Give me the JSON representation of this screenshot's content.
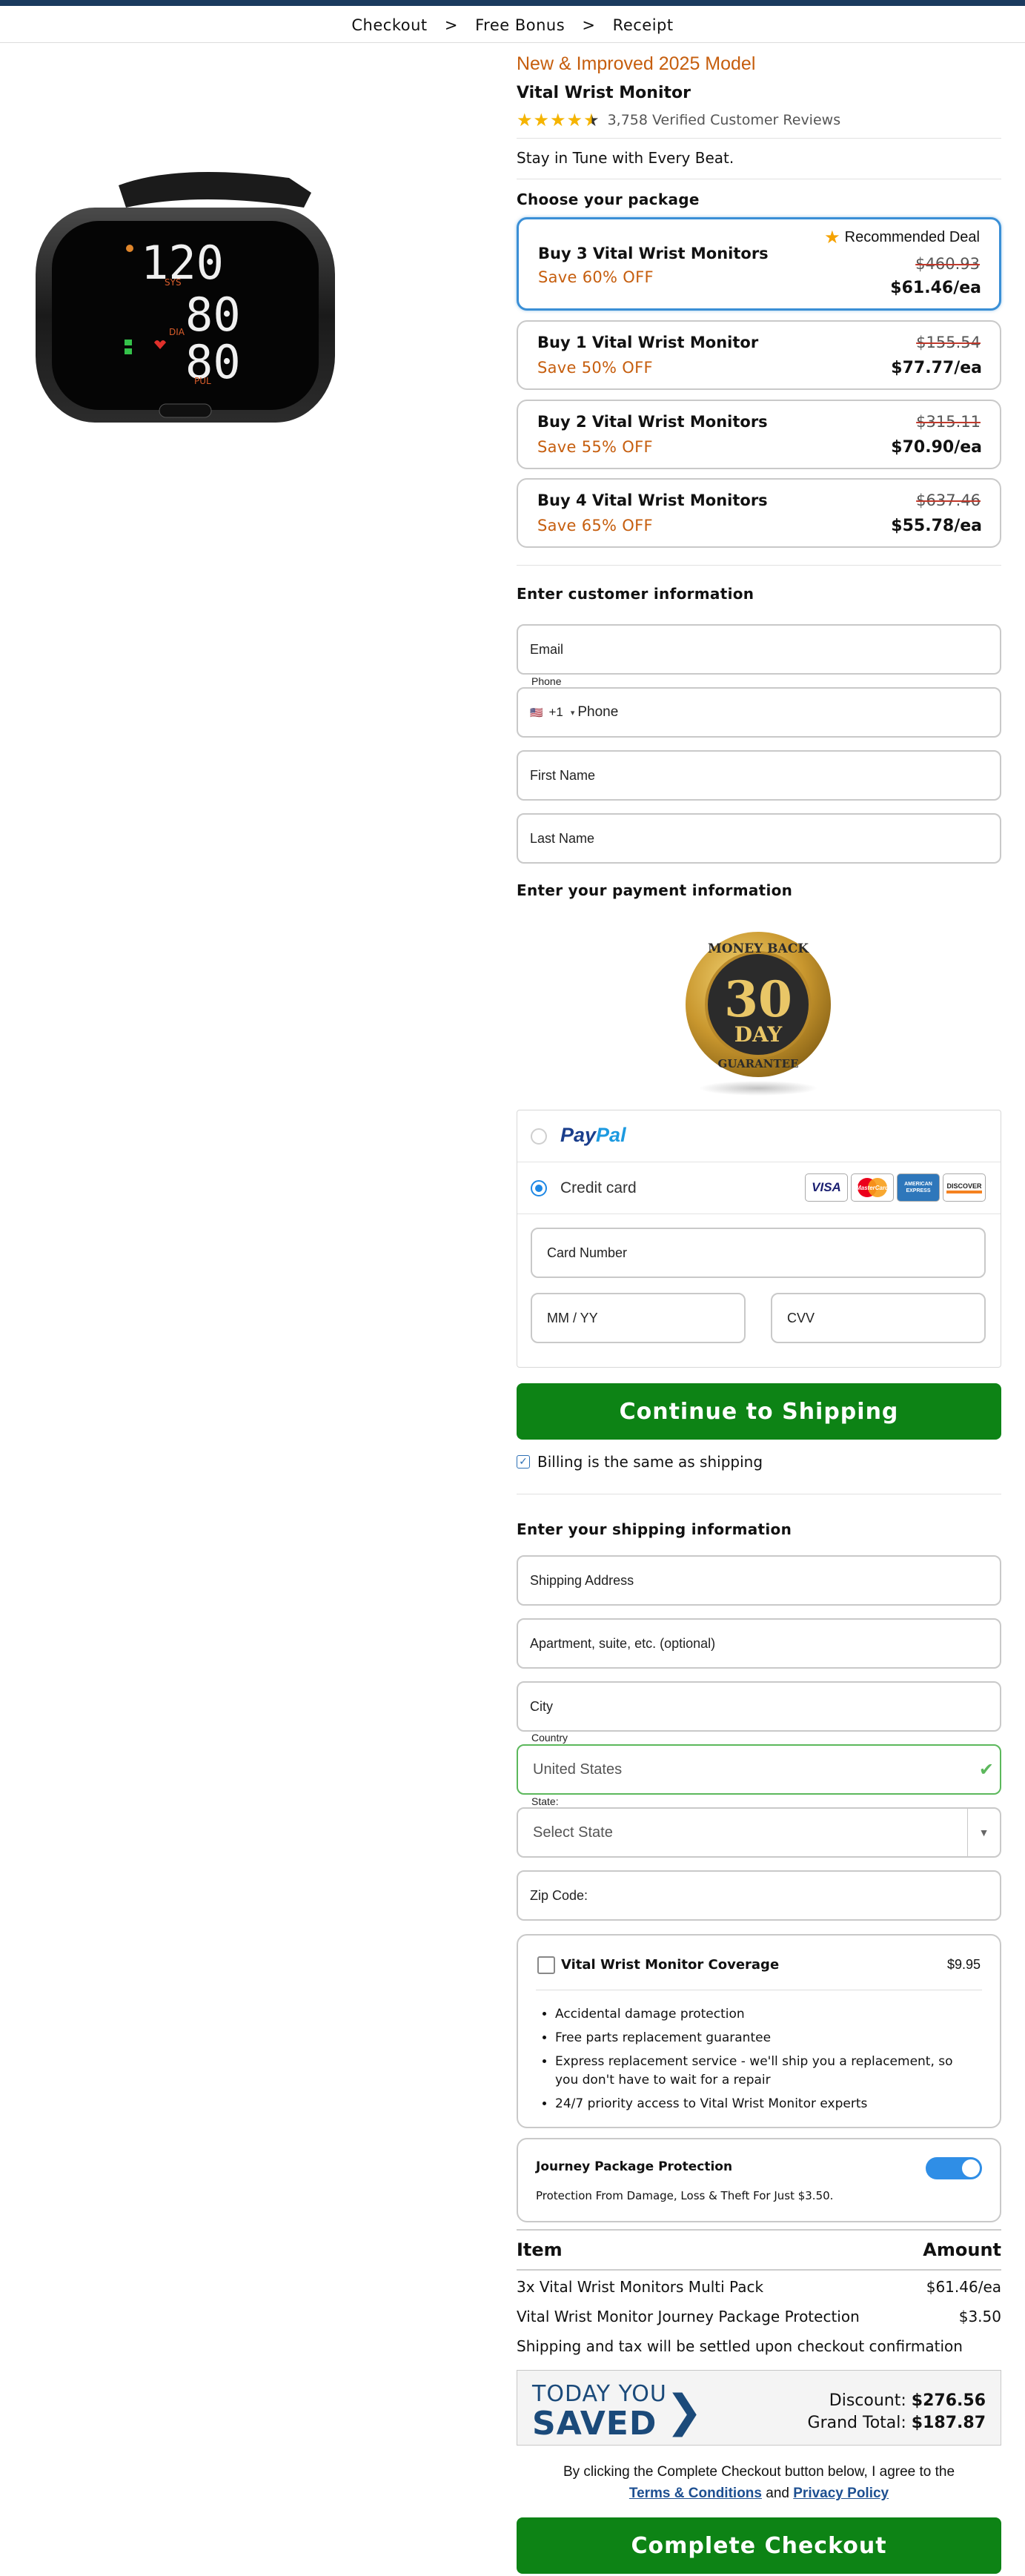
{
  "breadcrumb": [
    "Checkout",
    "Free Bonus",
    "Receipt"
  ],
  "breadcrumb_separator": ">",
  "product": {
    "subtitle": "New & Improved 2025 Model",
    "title": "Vital Wrist Monitor",
    "rating_stars": 4.5,
    "reviews": "3,758 Verified Customer Reviews",
    "tagline": "Stay in Tune with Every Beat.",
    "image_readings": [
      "120",
      "80",
      "80"
    ],
    "image_labels": [
      "SYS",
      "DIA",
      "PUL"
    ]
  },
  "packages_heading": "Choose your package",
  "packages": [
    {
      "name": "Buy 3 Vital Wrist Monitors",
      "save": "Save 60% OFF",
      "old": "$460.93",
      "price": "$61.46/ea",
      "badge": "Recommended Deal",
      "selected": true
    },
    {
      "name": "Buy 1 Vital Wrist Monitor",
      "save": "Save 50% OFF",
      "old": "$155.54",
      "price": "$77.77/ea"
    },
    {
      "name": "Buy 2 Vital Wrist Monitors",
      "save": "Save 55% OFF",
      "old": "$315.11",
      "price": "$70.90/ea"
    },
    {
      "name": "Buy 4 Vital Wrist Monitors",
      "save": "Save 65% OFF",
      "old": "$637.46",
      "price": "$55.78/ea"
    }
  ],
  "customer": {
    "heading": "Enter customer information",
    "email": "Email",
    "phone_label": "Phone",
    "phone_code": "+1",
    "phone_placeholder": "Phone",
    "first_name": "First Name",
    "last_name": "Last Name"
  },
  "payment": {
    "heading": "Enter your payment information",
    "guarantee": {
      "top": "MONEY BACK",
      "num": "30",
      "day": "DAY",
      "bottom": "GUARANTEE"
    },
    "paypal_1": "Pay",
    "paypal_2": "Pal",
    "credit_card": "Credit card",
    "cards": [
      "VISA",
      "MasterCard",
      "AMERICAN EXPRESS",
      "DISCOVER"
    ],
    "card_number": "Card Number",
    "expiry": "MM / YY",
    "cvv": "CVV"
  },
  "continue_button": "Continue to Shipping",
  "billing_same": "Billing is the same as shipping",
  "shipping": {
    "heading": "Enter your shipping information",
    "address": "Shipping Address",
    "apartment": "Apartment, suite, etc. (optional)",
    "city": "City",
    "country_label": "Country",
    "country_value": "United States",
    "state_label": "State:",
    "state_value": "Select State",
    "zip": "Zip Code:"
  },
  "coverage": {
    "title": "Vital Wrist Monitor Coverage",
    "price": "$9.95",
    "items": [
      "Accidental damage protection",
      "Free parts replacement guarantee",
      "Express replacement service - we'll ship you a replacement, so you don't have to wait for a repair",
      "24/7 priority access to Vital Wrist Monitor experts"
    ]
  },
  "journey": {
    "title": "Journey Package Protection",
    "desc": "Protection From Damage, Loss & Theft For Just $3.50.",
    "enabled": true
  },
  "summary": {
    "col_item": "Item",
    "col_amount": "Amount",
    "rows": [
      {
        "item": "3x Vital Wrist Monitors Multi Pack",
        "amount": "$61.46/ea"
      },
      {
        "item": "Vital Wrist Monitor Journey Package Protection",
        "amount": "$3.50"
      }
    ],
    "note": "Shipping and tax will be settled upon checkout confirmation"
  },
  "saved": {
    "today": "TODAY YOU",
    "saved": "SAVED",
    "discount_label": "Discount:",
    "discount": "$276.56",
    "total_label": "Grand Total:",
    "total": "$187.87"
  },
  "agreement": {
    "text": "By clicking the Complete Checkout button below, I agree to the",
    "terms": "Terms & Conditions",
    "and": "and",
    "privacy": "Privacy Policy"
  },
  "complete_button": "Complete Checkout",
  "colors": {
    "accent_orange": "#c65e0e",
    "button_green": "#0d8315",
    "selected_blue": "#3a8fd6",
    "navy": "#1b4a7a"
  }
}
